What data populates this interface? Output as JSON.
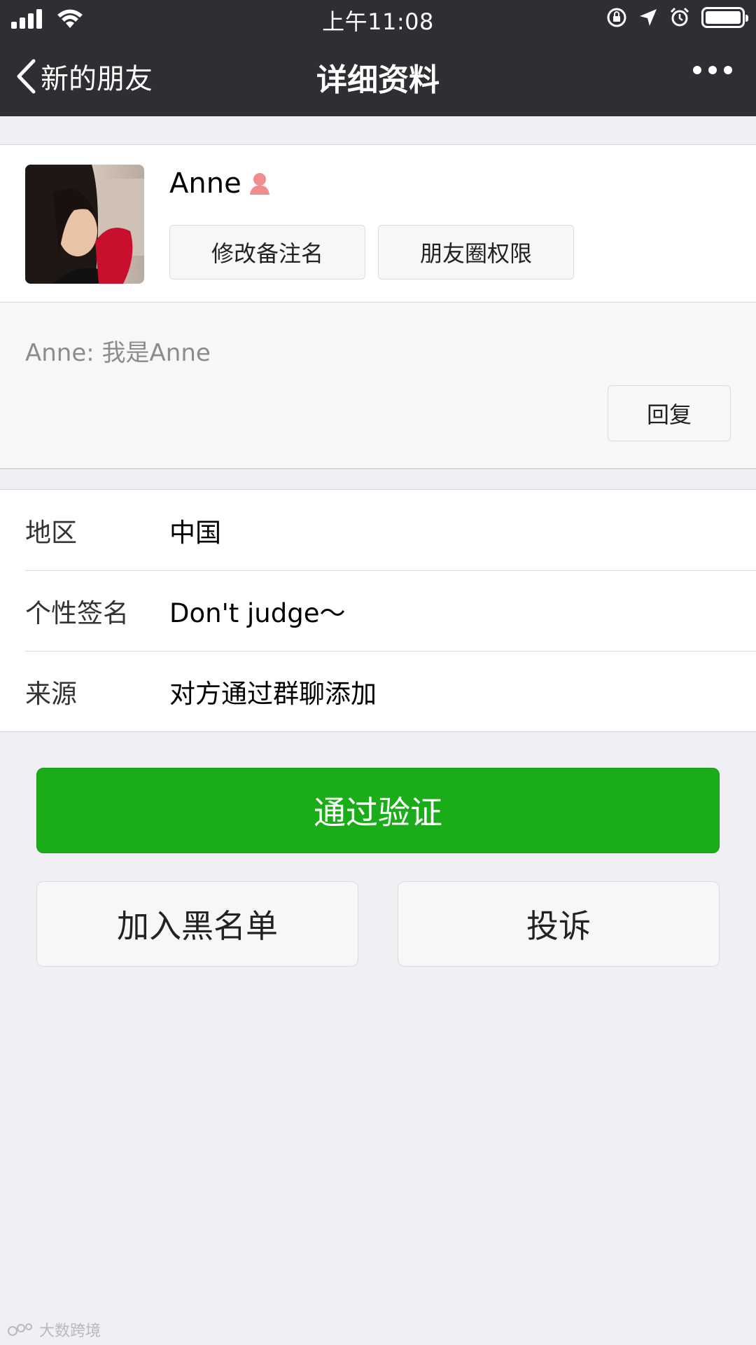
{
  "status_bar": {
    "time": "上午11:08"
  },
  "nav": {
    "back_label": "新的朋友",
    "title": "详细资料"
  },
  "profile": {
    "name": "Anne",
    "actions": [
      "修改备注名",
      "朋友圈权限"
    ]
  },
  "message": {
    "text": "Anne: 我是Anne",
    "reply_label": "回复"
  },
  "info": [
    {
      "label": "地区",
      "value": "中国"
    },
    {
      "label": "个性签名",
      "value": "Don't  judge～"
    },
    {
      "label": "来源",
      "value": "对方通过群聊添加"
    }
  ],
  "buttons": {
    "primary": "通过验证",
    "blacklist": "加入黑名单",
    "report": "投诉"
  },
  "watermark": "大数跨境",
  "colors": {
    "nav_bg": "#2e2e33",
    "primary_green": "#1aad19",
    "page_bg": "#efeff4",
    "female_icon": "#f08d8d"
  },
  "icons": [
    "signal-icon",
    "wifi-icon",
    "orientation-lock-icon",
    "location-icon",
    "alarm-icon",
    "battery-icon",
    "back-chevron-icon",
    "more-icon",
    "female-icon"
  ]
}
